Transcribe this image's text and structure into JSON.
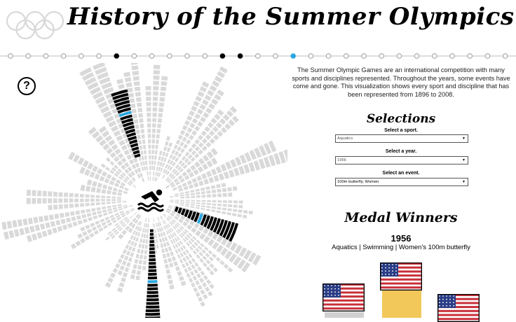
{
  "header": {
    "title": "History of the Summer Olympics",
    "rings_icon": "olympic-rings-icon",
    "ring_color": "#d9d9d9"
  },
  "timeline": {
    "dot_count": 30,
    "filled_dots": [
      6,
      12,
      13
    ],
    "selected_dot": 16,
    "filled_color": "#000000",
    "selected_color": "#2aa6de",
    "empty_color": "#ffffff"
  },
  "help": {
    "label": "?"
  },
  "description": "The Summer Olympic Games are an international competition with many sports and disciplines represented. Throughout the years, some events have come and gone. This visualization shows every sport and discipline that has been represented from 1896 to 2008.",
  "selections": {
    "title": "Selections",
    "sport_label": "Select a sport.",
    "sport_value": "Aquatics",
    "year_label": "Select a year.",
    "year_value": "1956",
    "event_label": "Select an event.",
    "event_value": "100m butterfly, Women"
  },
  "medals": {
    "title": "Medal Winners",
    "year": "1956",
    "event_line": "Aquatics | Swimming | Women's 100m butterfly",
    "gold_country": "USA",
    "silver_country": "USA",
    "bronze_country": "USA",
    "gold_color": "#f2c85b",
    "silver_color": "#d0d0d0",
    "bronze_color": "#c9884a"
  },
  "chart": {
    "center_icon": "swimmer-icon",
    "sector_count": 27,
    "highlight_color": "#000000",
    "selected_color": "#2aa6de",
    "inactive_color": "#d9d9d9"
  }
}
